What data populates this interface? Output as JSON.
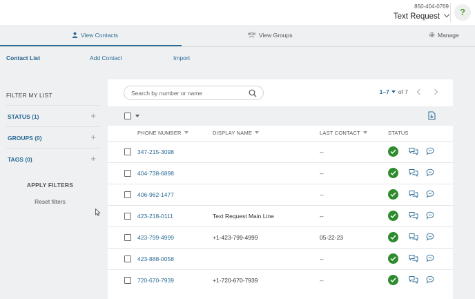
{
  "header": {
    "account_phone": "850-404-0769",
    "account_name": "Text Request",
    "help_label": "?"
  },
  "tabs": [
    {
      "label": "View Contacts",
      "active": true
    },
    {
      "label": "View Groups",
      "active": false
    },
    {
      "label": "Manage",
      "active": false
    }
  ],
  "subtabs": [
    {
      "label": "Contact List",
      "active": true
    },
    {
      "label": "Add Contact",
      "active": false
    },
    {
      "label": "Import",
      "active": false
    }
  ],
  "sidebar": {
    "title": "FILTER MY LIST",
    "filters": [
      {
        "label": "STATUS (1)"
      },
      {
        "label": "GROUPS (0)"
      },
      {
        "label": "TAGS (0)"
      }
    ],
    "apply_label": "APPLY FILTERS",
    "reset_label": "Reset filters"
  },
  "search": {
    "placeholder": "Search by number or name",
    "value": ""
  },
  "pager": {
    "range": "1–7",
    "of_label": "of 7"
  },
  "table": {
    "columns": [
      "PHONE NUMBER",
      "DISPLAY NAME",
      "LAST CONTACT",
      "STATUS"
    ],
    "rows": [
      {
        "phone": "347-215-3098",
        "display_name": "",
        "last_contact": "--"
      },
      {
        "phone": "404-738-6898",
        "display_name": "",
        "last_contact": "--"
      },
      {
        "phone": "406-962-1477",
        "display_name": "",
        "last_contact": "--"
      },
      {
        "phone": "423-218-0111",
        "display_name": "Text Request Main Line",
        "last_contact": "--"
      },
      {
        "phone": "423-799-4999",
        "display_name": "+1-423-799-4999",
        "last_contact": "05-22-23"
      },
      {
        "phone": "423-888-0058",
        "display_name": "",
        "last_contact": "--"
      },
      {
        "phone": "720-670-7939",
        "display_name": "+1-720-670-7939",
        "last_contact": "--"
      }
    ]
  },
  "colors": {
    "accent": "#2a6b96",
    "status_ok": "#2e8b2e",
    "help_icon": "#4f9a3a"
  }
}
